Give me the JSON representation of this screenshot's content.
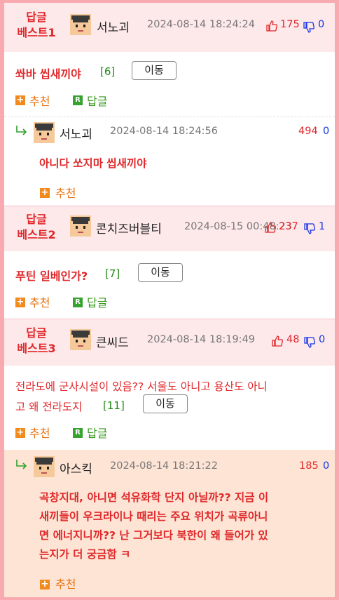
{
  "posts": [
    {
      "best_line1": "답글",
      "best_line2": "베스트1",
      "nick": "서노괴",
      "date": "2024-08-14 18:24:24",
      "up": "175",
      "down": "0",
      "title": "쏴바 씹새끼야",
      "count": "[6]",
      "move": "이동",
      "recommend": "추천",
      "reply": "답글",
      "comment": {
        "nick": "서노괴",
        "date": "2024-08-14 18:24:56",
        "up": "494",
        "down": "0",
        "text": "아니다 쏘지마 씹새끼야",
        "recommend": "추천"
      }
    },
    {
      "best_line1": "답글",
      "best_line2": "베스트2",
      "nick": "콘치즈버블티",
      "date": "2024-08-15 00:48:23",
      "up": "237",
      "down": "1",
      "title": "푸틴 일베인가?",
      "count": "[7]",
      "move": "이동",
      "recommend": "추천",
      "reply": "답글"
    },
    {
      "best_line1": "답글",
      "best_line2": "베스트3",
      "nick": "큰씨드",
      "date": "2024-08-14 18:19:49",
      "up": "48",
      "down": "0",
      "title_line1": "전라도에 군사시설이 있음?? 서울도 아니고 용산도 아니",
      "title_line2": "고 왜 전라도지",
      "count": "[11]",
      "move": "이동",
      "recommend": "추천",
      "reply": "답글",
      "comment": {
        "nick": "아스킥",
        "date": "2024-08-14 18:21:22",
        "up": "185",
        "down": "0",
        "text_line1": "곡창지대, 아니면 석유화학 단지 아닐까?? 지금 이",
        "text_line2": "새끼들이 우크라이나 때리는 주요 위치가 곡류아니",
        "text_line3": "면 에너지니까?? 난 그거보다 북한이 왜 들어가 있",
        "text_line4": "는지가 더 궁금함 ㅋ",
        "recommend": "추천"
      }
    }
  ],
  "colors": {
    "best_red": "#e0282b",
    "up_red": "#e0282b",
    "down_blue": "#1535e6",
    "count_green": "#1f8a12",
    "recommend_orange": "#e7720f",
    "reply_green": "#3a9a1e",
    "frame_pink": "#f9aab0"
  },
  "icons": [
    "avatar",
    "thumbs-up-icon",
    "thumbs-down-icon",
    "plus-icon",
    "reply-r-icon",
    "reply-arrow-icon"
  ]
}
